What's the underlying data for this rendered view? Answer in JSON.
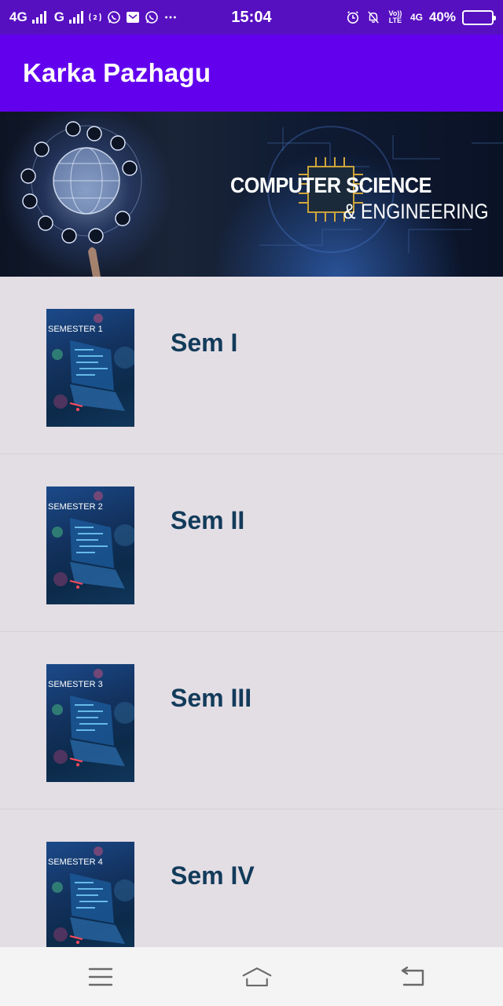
{
  "status_bar": {
    "network_1": "4G",
    "network_2": "G",
    "time": "15:04",
    "volte": "Vo)) LTE",
    "network_3": "4G",
    "battery_percent": "40%",
    "battery_level": 0.4
  },
  "app_bar": {
    "title": "Karka Pazhagu"
  },
  "banner": {
    "line1": "COMPUTER SCIENCE",
    "line2": "& ENGINEERING"
  },
  "semesters": [
    {
      "thumb_label": "SEMESTER 1",
      "title": "Sem I"
    },
    {
      "thumb_label": "SEMESTER 2",
      "title": "Sem II"
    },
    {
      "thumb_label": "SEMESTER 3",
      "title": "Sem III"
    },
    {
      "thumb_label": "SEMESTER 4",
      "title": "Sem IV"
    }
  ],
  "nav_bar": {
    "icons": [
      "menu-icon",
      "home-icon",
      "back-icon"
    ]
  }
}
